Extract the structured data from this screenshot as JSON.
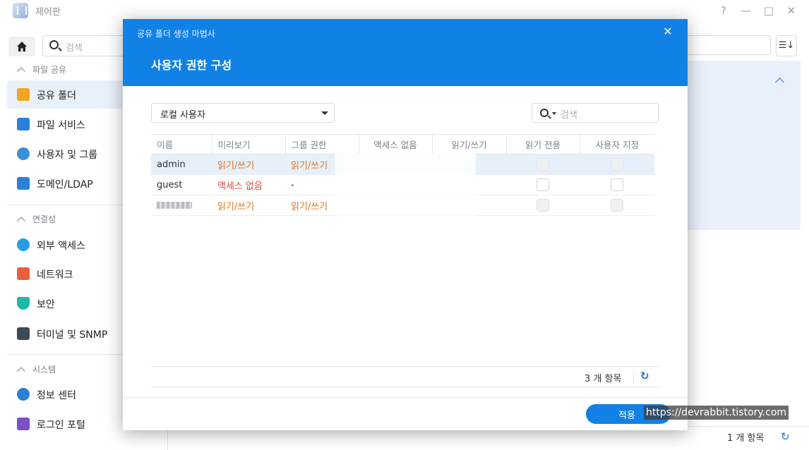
{
  "window": {
    "title": "제어판",
    "help": "?",
    "minimize": "—",
    "maximize": "□",
    "close": "✕"
  },
  "sidebar": {
    "search_placeholder": "검색",
    "sections": [
      {
        "label": "파일 공유",
        "items": [
          "공유 폴더",
          "파일 서비스",
          "사용자 및 그룹",
          "도메인/LDAP"
        ]
      },
      {
        "label": "연결성",
        "items": [
          "외부 액세스",
          "네트워크",
          "보안",
          "터미널 및 SNMP"
        ]
      },
      {
        "label": "시스템",
        "items": [
          "정보 센터",
          "로그인 포털"
        ]
      }
    ]
  },
  "main": {
    "item_count": "1 개 항목",
    "refresh_icon": "refresh-icon"
  },
  "dialog": {
    "wizard_title": "공유 폴더 생성 마법사",
    "step_title": "사용자 권한 구성",
    "close": "✕",
    "user_type": "로컬 사용자",
    "search_placeholder": "검색",
    "columns": [
      "이름",
      "미리보기",
      "그룹 권한",
      "액세스 없음",
      "읽기/쓰기",
      "읽기 전용",
      "사용자 지정"
    ],
    "rows": [
      {
        "name": "admin",
        "preview": "읽기/쓰기",
        "group": "읽기/쓰기"
      },
      {
        "name": "guest",
        "preview": "액세스 없음",
        "group": "-"
      },
      {
        "name": "",
        "preview": "읽기/쓰기",
        "group": "읽기/쓰기"
      }
    ],
    "item_count": "3 개 항목",
    "refresh": "↻",
    "apply": "적용"
  },
  "watermark": "https://devrabbit.tistory.com",
  "colors": {
    "accent": "#1281e6",
    "orange": "#e0751b",
    "red": "#d8483a",
    "selection": "#e5f0fb"
  }
}
